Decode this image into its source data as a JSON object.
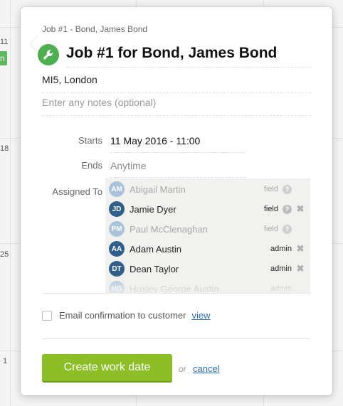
{
  "calendar": {
    "day_numbers": [
      "11",
      "18",
      "25",
      "1"
    ],
    "chip_label": "n"
  },
  "popup": {
    "breadcrumb": "Job #1 - Bond, James Bond",
    "title": "Job #1 for Bond, James Bond",
    "title_icon": "wrench-icon",
    "location": "MI5, London",
    "notes_placeholder": "Enter any notes (optional)",
    "starts_label": "Starts",
    "starts_value": "11 May 2016 - 11:00",
    "ends_label": "Ends",
    "ends_value": "Anytime",
    "assigned_label": "Assigned To",
    "assignees": [
      {
        "initials": "AM",
        "name": "Abigail Martin",
        "role": "field",
        "assigned": false,
        "help": true,
        "remove": false
      },
      {
        "initials": "JD",
        "name": "Jamie Dyer",
        "role": "field",
        "assigned": true,
        "help": true,
        "remove": true
      },
      {
        "initials": "PM",
        "name": "Paul McClenaghan",
        "role": "field",
        "assigned": false,
        "help": true,
        "remove": false
      },
      {
        "initials": "AA",
        "name": "Adam Austin",
        "role": "admin",
        "assigned": true,
        "help": false,
        "remove": true
      },
      {
        "initials": "DT",
        "name": "Dean Taylor",
        "role": "admin",
        "assigned": true,
        "help": false,
        "remove": true
      },
      {
        "initials": "HG",
        "name": "Huxley George Austin",
        "role": "admin",
        "assigned": false,
        "help": false,
        "remove": false
      }
    ],
    "email_confirmation_label": "Email confirmation to customer",
    "view_link": "view",
    "create_button": "Create work date",
    "or_text": "or",
    "cancel_link": "cancel"
  },
  "colors": {
    "primary_button": "#8cbf26",
    "icon_green": "#4caf50",
    "avatar_active": "#2f5f8a",
    "avatar_inactive": "#a9c2da",
    "link": "#2a6fb5"
  }
}
